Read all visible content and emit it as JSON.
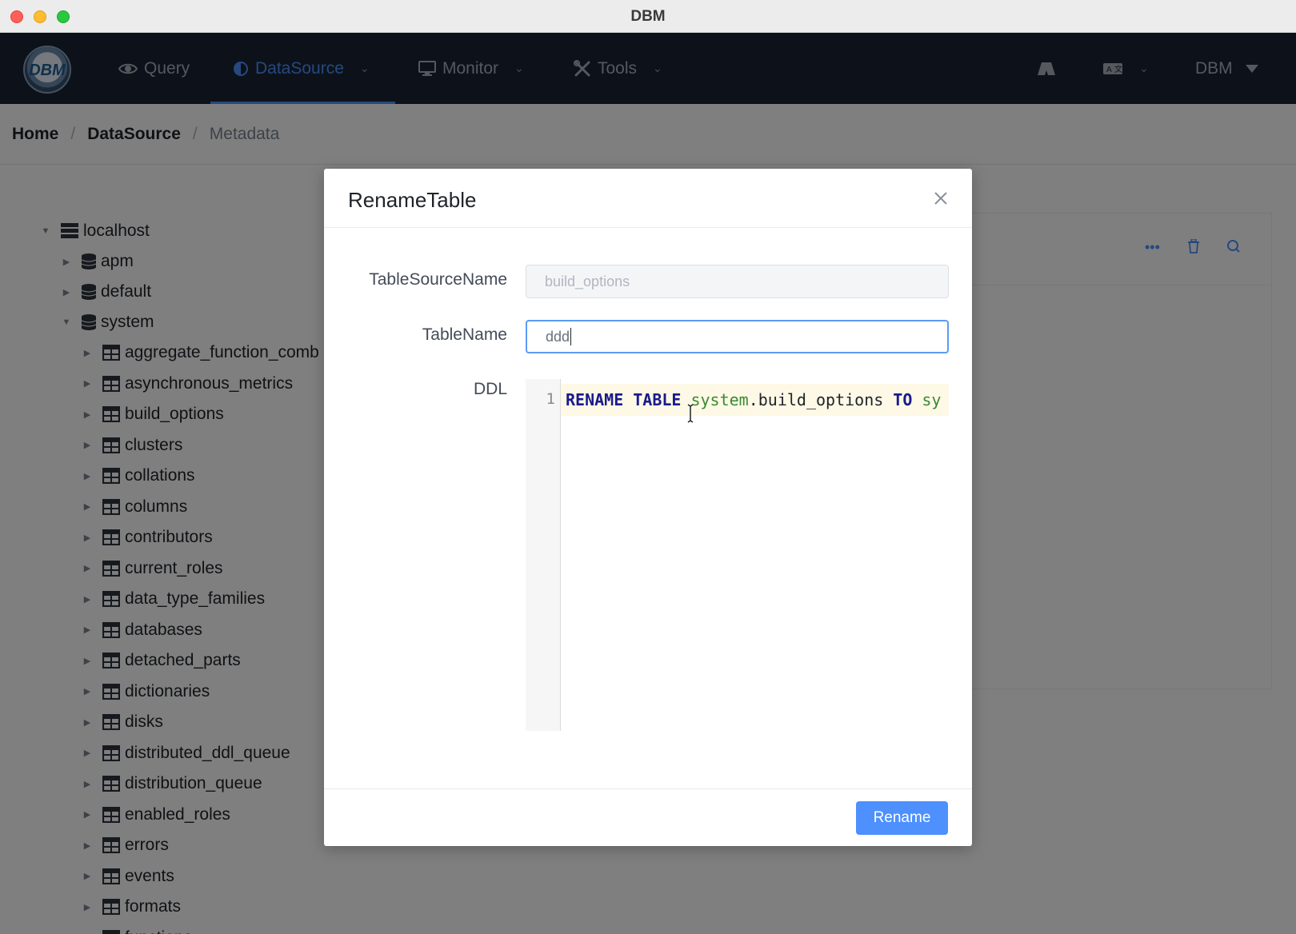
{
  "window": {
    "title": "DBM"
  },
  "nav": {
    "items": [
      {
        "label": "Query",
        "icon": "eye-icon"
      },
      {
        "label": "DataSource",
        "icon": "half-circle-icon",
        "active": true
      },
      {
        "label": "Monitor",
        "icon": "monitor-icon"
      },
      {
        "label": "Tools",
        "icon": "tools-icon"
      }
    ],
    "user_label": "DBM",
    "accent_color": "#4d90fe"
  },
  "breadcrumb": {
    "home": "Home",
    "datasource": "DataSource",
    "current": "Metadata"
  },
  "tree": {
    "root": "localhost",
    "databases": [
      "apm",
      "default",
      "system"
    ],
    "tables": [
      "aggregate_function_comb",
      "asynchronous_metrics",
      "build_options",
      "clusters",
      "collations",
      "columns",
      "contributors",
      "current_roles",
      "data_type_families",
      "databases",
      "detached_parts",
      "dictionaries",
      "disks",
      "distributed_ddl_queue",
      "distribution_queue",
      "enabled_roles",
      "errors",
      "events",
      "formats",
      "functions"
    ]
  },
  "modal": {
    "title": "RenameTable",
    "source_label": "TableSourceName",
    "source_value": "build_options",
    "name_label": "TableName",
    "name_value": "ddd",
    "ddl_label": "DDL",
    "ddl": {
      "line_number": "1",
      "kw1": "RENAME",
      "kw2": "TABLE",
      "db1": "system",
      "rest1": ".build_options",
      "kw3": "TO",
      "db2": "sy"
    },
    "rename_button": "Rename"
  }
}
